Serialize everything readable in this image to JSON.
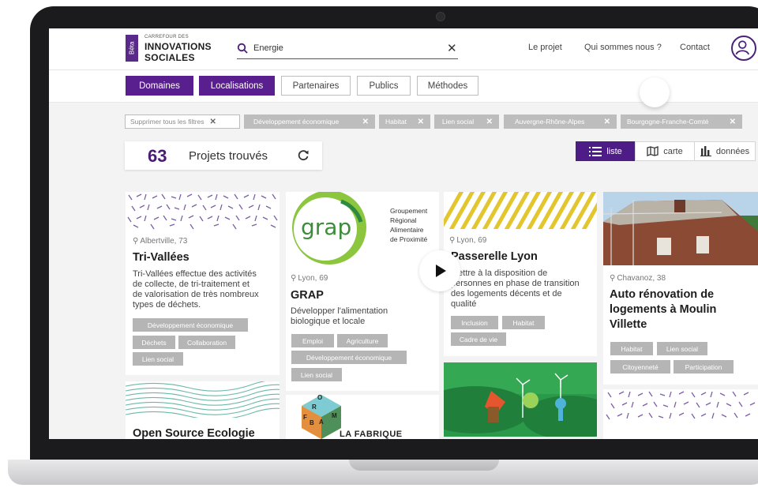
{
  "header": {
    "beta": "Bêta",
    "logo_small": "CARREFOUR DES",
    "logo_line1": "INNOVATIONS",
    "logo_line2": "SOCIALES",
    "search_value": "Energie",
    "nav": [
      "Le projet",
      "Qui sommes nous ?",
      "Contact"
    ]
  },
  "filters": {
    "buttons": [
      "Domaines",
      "Localisations",
      "Partenaires",
      "Publics",
      "Méthodes"
    ],
    "active": [
      "Domaines",
      "Localisations"
    ],
    "chips": [
      "Supprimer tous les filtres",
      "Développement économique",
      "Habitat",
      "Lien social",
      "Auvergne-Rhône-Alpes",
      "Bourgogne-Franche-Comté"
    ]
  },
  "results": {
    "count": "63",
    "label": "Projets trouvés"
  },
  "view": {
    "options": [
      "liste",
      "carte",
      "données"
    ],
    "active": "liste"
  },
  "cards": [
    {
      "location": "Albertville, 73",
      "title": "Tri-Vallées",
      "desc": [
        "Tri-Vallées effectue des activités",
        "de collecte, de tri-traitement et",
        "de valorisation de très nombreux",
        "types de déchets."
      ],
      "tags": [
        "Développement économique",
        "Déchets",
        "Collaboration",
        "Lien social"
      ]
    },
    {
      "logo_text": "grap",
      "logo_caption": [
        "Groupement",
        "Régional",
        "Alimentaire",
        "de Proximité"
      ],
      "location": "Lyon, 69",
      "title": "GRAP",
      "desc": [
        "Développer l'alimentation",
        "biologique et locale"
      ],
      "tags": [
        "Emploi",
        "Agriculture",
        "Développement économique",
        "Lien social"
      ]
    },
    {
      "location": "Lyon, 69",
      "title": "Passerelle Lyon",
      "desc": [
        "Mettre à la disposition de",
        "personnes en phase de transition",
        "des logements décents et de",
        "qualité"
      ],
      "tags": [
        "Inclusion",
        "Habitat",
        "Cadre de vie"
      ]
    },
    {
      "location": "Chavanoz, 38",
      "title": [
        "Auto rénovation de",
        "logements à Moulin",
        "Villette"
      ],
      "tags": [
        "Habitat",
        "Lien social",
        "Citoyenneté",
        "Participation"
      ]
    },
    {
      "title": "Open Source Ecologie"
    },
    {
      "logo_letters": [
        "F",
        "A",
        "B",
        "R",
        "O",
        "M"
      ],
      "logo_text": "LA FABRIQUE"
    }
  ],
  "colors": {
    "brand": "#5a1f8e",
    "tag": "#b5b5b5",
    "pattern_purple": "#7b5ea7",
    "pattern_teal": "#6bb8a8",
    "pattern_yellow": "#e3c62e"
  }
}
